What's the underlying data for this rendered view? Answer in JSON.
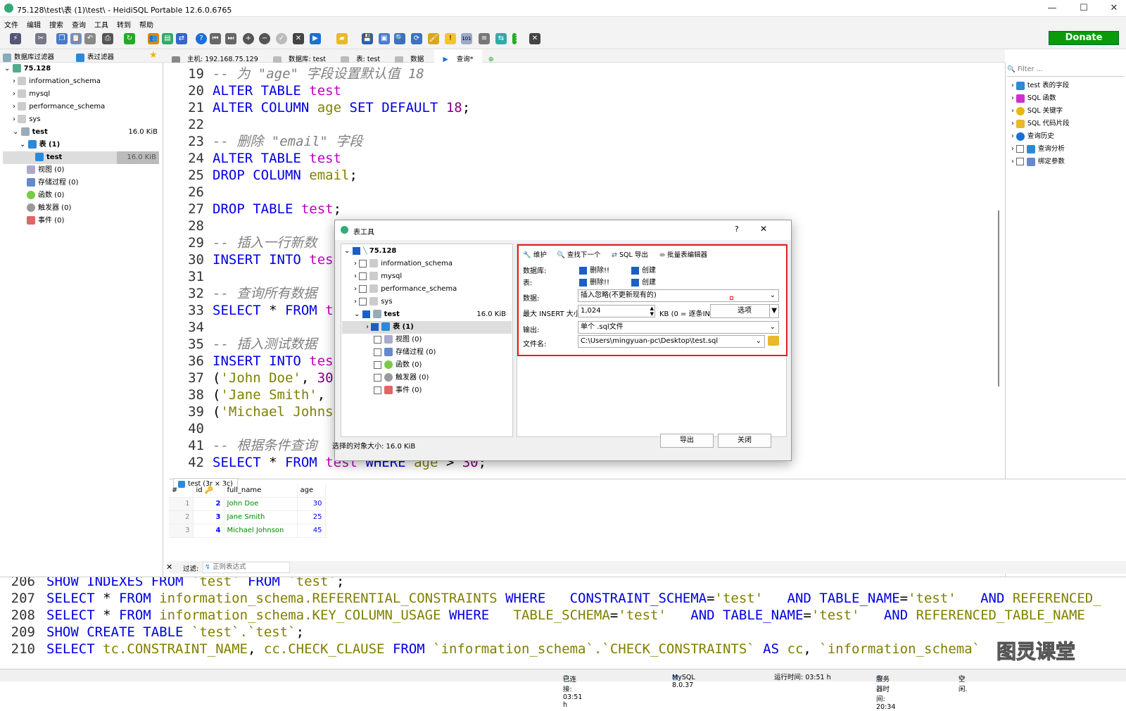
{
  "window": {
    "title": "75.128\\test\\表 (1)\\test\\ - HeidiSQL Portable 12.6.0.6765",
    "min": "—",
    "max": "☐",
    "close": "✕"
  },
  "menu": [
    "文件",
    "编辑",
    "搜索",
    "查询",
    "工具",
    "转到",
    "帮助"
  ],
  "donate": "Donate",
  "filters": {
    "db_filter": "数据库过滤器",
    "table_filter": "表过滤器"
  },
  "tabs": [
    "主机: 192.168.75.129",
    "数据库: test",
    "表: test",
    "数据",
    "查询*"
  ],
  "tree": {
    "root": "75.128",
    "items": [
      {
        "label": "information_schema"
      },
      {
        "label": "mysql"
      },
      {
        "label": "performance_schema"
      },
      {
        "label": "sys"
      },
      {
        "label": "test",
        "size": "16.0 KiB"
      }
    ],
    "tables_node": "表 (1)",
    "table": {
      "label": "test",
      "size": "16.0 KiB"
    },
    "others": [
      "视图 (0)",
      "存储过程 (0)",
      "函数 (0)",
      "触发器 (0)",
      "事件 (0)"
    ]
  },
  "editor": {
    "lines": [
      "19",
      "20",
      "21",
      "22",
      "23",
      "24",
      "25",
      "26",
      "27",
      "28",
      "29",
      "30",
      "31",
      "32",
      "33",
      "34",
      "35",
      "36",
      "37",
      "38",
      "39",
      "40",
      "41",
      "42"
    ]
  },
  "right_panel": {
    "filter_placeholder": "Filter ...",
    "items": [
      "test 表的字段",
      "SQL 函数",
      "SQL 关键字",
      "SQL 代码片段",
      "查询历史",
      "查询分析",
      "绑定参数"
    ]
  },
  "results": {
    "tab": "test (3r × 3c)",
    "columns": [
      "#",
      "id",
      "full_name",
      "age"
    ],
    "rows": [
      [
        "1",
        "2",
        "John Doe",
        "30"
      ],
      [
        "2",
        "3",
        "Jane Smith",
        "25"
      ],
      [
        "3",
        "4",
        "Michael Johnson",
        "45"
      ]
    ]
  },
  "filterbar": {
    "label": "过滤:",
    "placeholder": "正则表达式"
  },
  "log": {
    "lines": [
      "206",
      "207",
      "208",
      "209",
      "210"
    ]
  },
  "status": {
    "connected": "已连接: 03:51 h",
    "server": "MySQL 8.0.37",
    "uptime": "运行时间: 03:51 h",
    "server_time": "服务器时间: 20:34",
    "idle": "空闲."
  },
  "watermark": "图灵课堂",
  "dialog": {
    "title": "表工具",
    "help": "?",
    "close": "✕",
    "tree": {
      "root": "75.128",
      "items": [
        "information_schema",
        "mysql",
        "performance_schema",
        "sys"
      ],
      "db": "test",
      "db_size": "16.0 KiB",
      "tables": "表 (1)",
      "others": [
        "视图 (0)",
        "存储过程 (0)",
        "函数 (0)",
        "触发器 (0)",
        "事件 (0)"
      ]
    },
    "tabs": [
      "维护",
      "查找下一个",
      "SQL 导出",
      "批量表编辑器"
    ],
    "db_label": "数据库:",
    "table_label": "表:",
    "drop": "删除!!",
    "create": "创建",
    "data_label": "数据:",
    "data_value": "插入忽略(不更新现有的)",
    "max_insert_label": "最大 INSERT 大小",
    "max_insert_value": "1,024",
    "kb_hint": "KB (0 = 逐条IN",
    "options": "选项",
    "output_label": "输出:",
    "output_value": "单个 .sql文件",
    "filename_label": "文件名:",
    "filename_value": "C:\\Users\\mingyuan-pc\\Desktop\\test.sql",
    "selected_size": "选择的对象大小: 16.0 KiB",
    "export": "导出",
    "close_btn": "关闭"
  }
}
